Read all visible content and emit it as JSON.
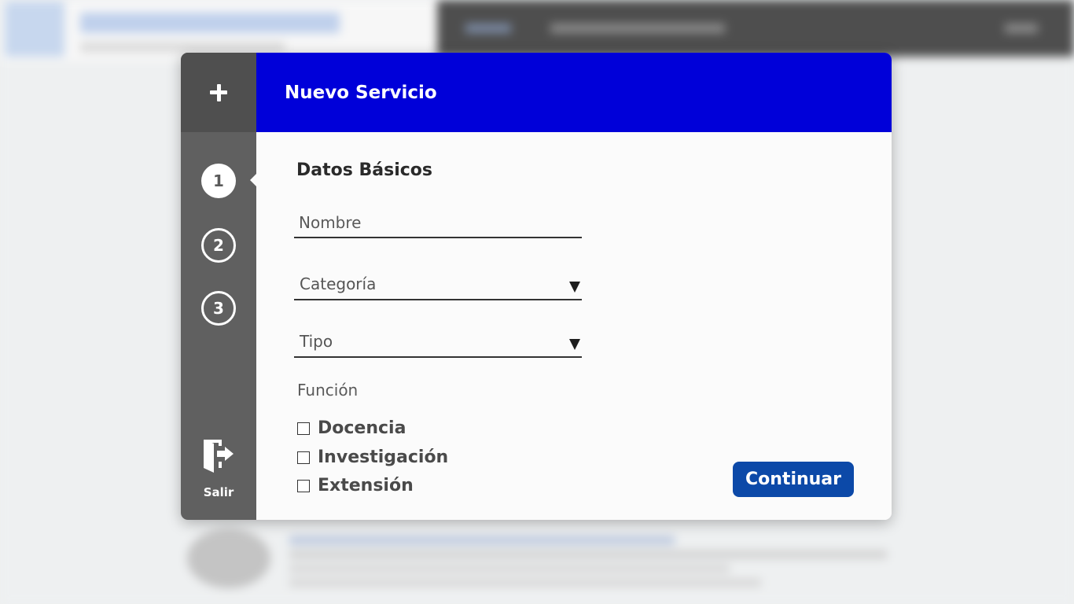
{
  "modal": {
    "title": "Nuevo Servicio",
    "add_icon": "plus-icon",
    "steps": [
      {
        "label": "1",
        "state": "active"
      },
      {
        "label": "2",
        "state": "inactive"
      },
      {
        "label": "3",
        "state": "inactive"
      }
    ],
    "exit": {
      "label": "Salir",
      "icon": "exit-door-icon"
    }
  },
  "form": {
    "section_title": "Datos Básicos",
    "nombre": {
      "placeholder": "Nombre",
      "value": ""
    },
    "categoria": {
      "placeholder": "Categoría",
      "value": ""
    },
    "tipo": {
      "placeholder": "Tipo",
      "value": ""
    },
    "funcion_label": "Función",
    "funciones": [
      {
        "label": "Docencia",
        "checked": false
      },
      {
        "label": "Investigación",
        "checked": false
      },
      {
        "label": "Extensión",
        "checked": false
      }
    ],
    "continue_label": "Continuar"
  },
  "colors": {
    "header_blue": "#0000d9",
    "button_blue": "#0c49a8",
    "sidebar_gray": "#606060",
    "sidebar_top_gray": "#4f4f4f"
  }
}
